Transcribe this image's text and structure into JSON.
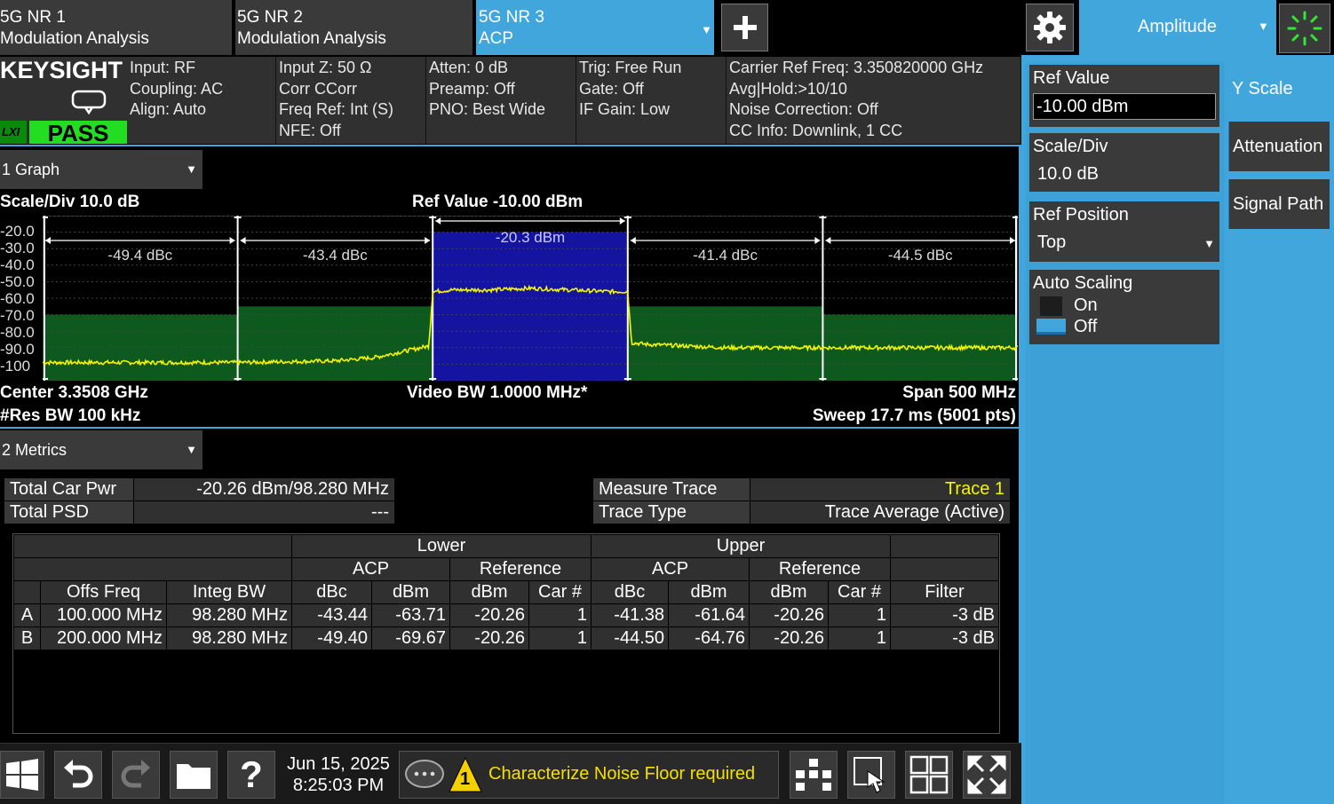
{
  "tabs": [
    {
      "line1": "5G NR 1",
      "line2": "Modulation Analysis"
    },
    {
      "line1": "5G NR 2",
      "line2": "Modulation Analysis"
    },
    {
      "line1": "5G NR 3",
      "line2": "ACP"
    }
  ],
  "menu": {
    "title": "Amplitude"
  },
  "brand": {
    "logo": "KEYSIGHT",
    "lxi": "LXI",
    "status": "PASS"
  },
  "header": {
    "col1": [
      "Input: RF",
      "Coupling: AC",
      "Align: Auto"
    ],
    "col2": [
      "Input Z: 50 Ω",
      "Corr CCorr",
      "Freq Ref: Int (S)",
      "NFE: Off"
    ],
    "col3": [
      "Atten: 0 dB",
      "Preamp: Off",
      "PNO: Best Wide"
    ],
    "col4": [
      "Trig: Free Run",
      "Gate: Off",
      "IF Gain: Low"
    ],
    "col5": [
      "Carrier Ref Freq: 3.350820000 GHz",
      "Avg|Hold:>10/10",
      "Noise Correction: Off",
      "CC Info: Downlink, 1 CC"
    ]
  },
  "graph": {
    "window_label": "1 Graph",
    "scale_div": "Scale/Div 10.0 dB",
    "ref_value": "Ref Value -10.00 dBm",
    "y_ticks": [
      "-20.0",
      "-30.0",
      "-40.0",
      "-50.0",
      "-60.0",
      "-70.0",
      "-80.0",
      "-90.0",
      "-100"
    ],
    "center": "Center 3.3508 GHz",
    "res_bw": "#Res BW 100 kHz",
    "video_bw": "Video BW 1.0000 MHz*",
    "span": "Span 500 MHz",
    "sweep": "Sweep 17.7 ms (5001 pts)",
    "segment_labels": [
      "-49.4 dBc",
      "-43.4 dBc",
      "-20.3 dBm",
      "-41.4 dBc",
      "-44.5 dBc"
    ]
  },
  "chart_data": {
    "type": "line",
    "title": "",
    "xlabel": "",
    "ylabel": "",
    "x_range_mhz": [
      -250,
      250
    ],
    "ylim": [
      -110,
      -10
    ],
    "y_unit": "dBm",
    "segments": [
      {
        "label": "-49.4 dBc",
        "x_mhz": [
          -250,
          -150
        ],
        "limit_dbm": -70
      },
      {
        "label": "-43.4 dBc",
        "x_mhz": [
          -150,
          -50
        ],
        "limit_dbm": -65
      },
      {
        "label": "-20.3 dBm",
        "x_mhz": [
          -50,
          50
        ],
        "limit_dbm": -20
      },
      {
        "label": "-41.4 dBc",
        "x_mhz": [
          50,
          150
        ],
        "limit_dbm": -65
      },
      {
        "label": "-44.5 dBc",
        "x_mhz": [
          150,
          250
        ],
        "limit_dbm": -70
      }
    ],
    "trace": {
      "x_mhz": [
        -250,
        -200,
        -150,
        -100,
        -80,
        -60,
        -52,
        -50,
        -40,
        -20,
        0,
        20,
        40,
        50,
        52,
        60,
        80,
        100,
        150,
        200,
        250
      ],
      "y_dbm": [
        -99,
        -99,
        -99,
        -98,
        -96,
        -91,
        -89,
        -56,
        -55,
        -55,
        -54,
        -55,
        -56,
        -56,
        -87,
        -88,
        -89,
        -90,
        -90,
        -90,
        -90
      ]
    }
  },
  "metrics": {
    "window_label": "2 Metrics",
    "rows": [
      {
        "label": "Total Car Pwr",
        "value": "-20.26 dBm/98.280 MHz"
      },
      {
        "label": "Total PSD",
        "value": "---"
      }
    ],
    "trace_rows": [
      {
        "label": "Measure Trace",
        "value": "Trace 1"
      },
      {
        "label": "Trace Type",
        "value": "Trace Average (Active)"
      }
    ],
    "acp_headers": {
      "lower": "Lower",
      "upper": "Upper",
      "acp": "ACP",
      "reference": "Reference",
      "offs_freq": "Offs Freq",
      "integ_bw": "Integ BW",
      "dbc": "dBc",
      "dbm": "dBm",
      "car": "Car #",
      "filter": "Filter"
    },
    "acp_rows": [
      {
        "id": "A",
        "offs": "100.000 MHz",
        "bw": "98.280 MHz",
        "l_dbc": "-43.44",
        "l_dbm": "-63.71",
        "l_ref": "-20.26",
        "l_car": "1",
        "u_dbc": "-41.38",
        "u_dbm": "-61.64",
        "u_ref": "-20.26",
        "u_car": "1",
        "filter": "-3 dB"
      },
      {
        "id": "B",
        "offs": "200.000 MHz",
        "bw": "98.280 MHz",
        "l_dbc": "-49.40",
        "l_dbm": "-69.67",
        "l_ref": "-20.26",
        "l_car": "1",
        "u_dbc": "-44.50",
        "u_dbm": "-64.76",
        "u_ref": "-20.26",
        "u_car": "1",
        "filter": "-3 dB"
      }
    ]
  },
  "softkeys": {
    "ref_value": {
      "label": "Ref Value",
      "value": "-10.00 dBm"
    },
    "scale_div": {
      "label": "Scale/Div",
      "value": "10.0 dB"
    },
    "ref_position": {
      "label": "Ref Position",
      "value": "Top"
    },
    "auto_scaling": {
      "label": "Auto Scaling",
      "on": "On",
      "off": "Off"
    }
  },
  "right_tabs": [
    "Y Scale",
    "Attenuation",
    "Signal Path"
  ],
  "taskbar": {
    "date": "Jun 15, 2025",
    "time": "8:25:03 PM",
    "alert_count": "1",
    "alert_text": "Characterize Noise Floor required"
  },
  "colors": {
    "accent": "#41a6dc",
    "pass": "#22dd22",
    "trace": "#f5f500",
    "carrier": "#1414a0",
    "limit": "#0e5a1e"
  }
}
